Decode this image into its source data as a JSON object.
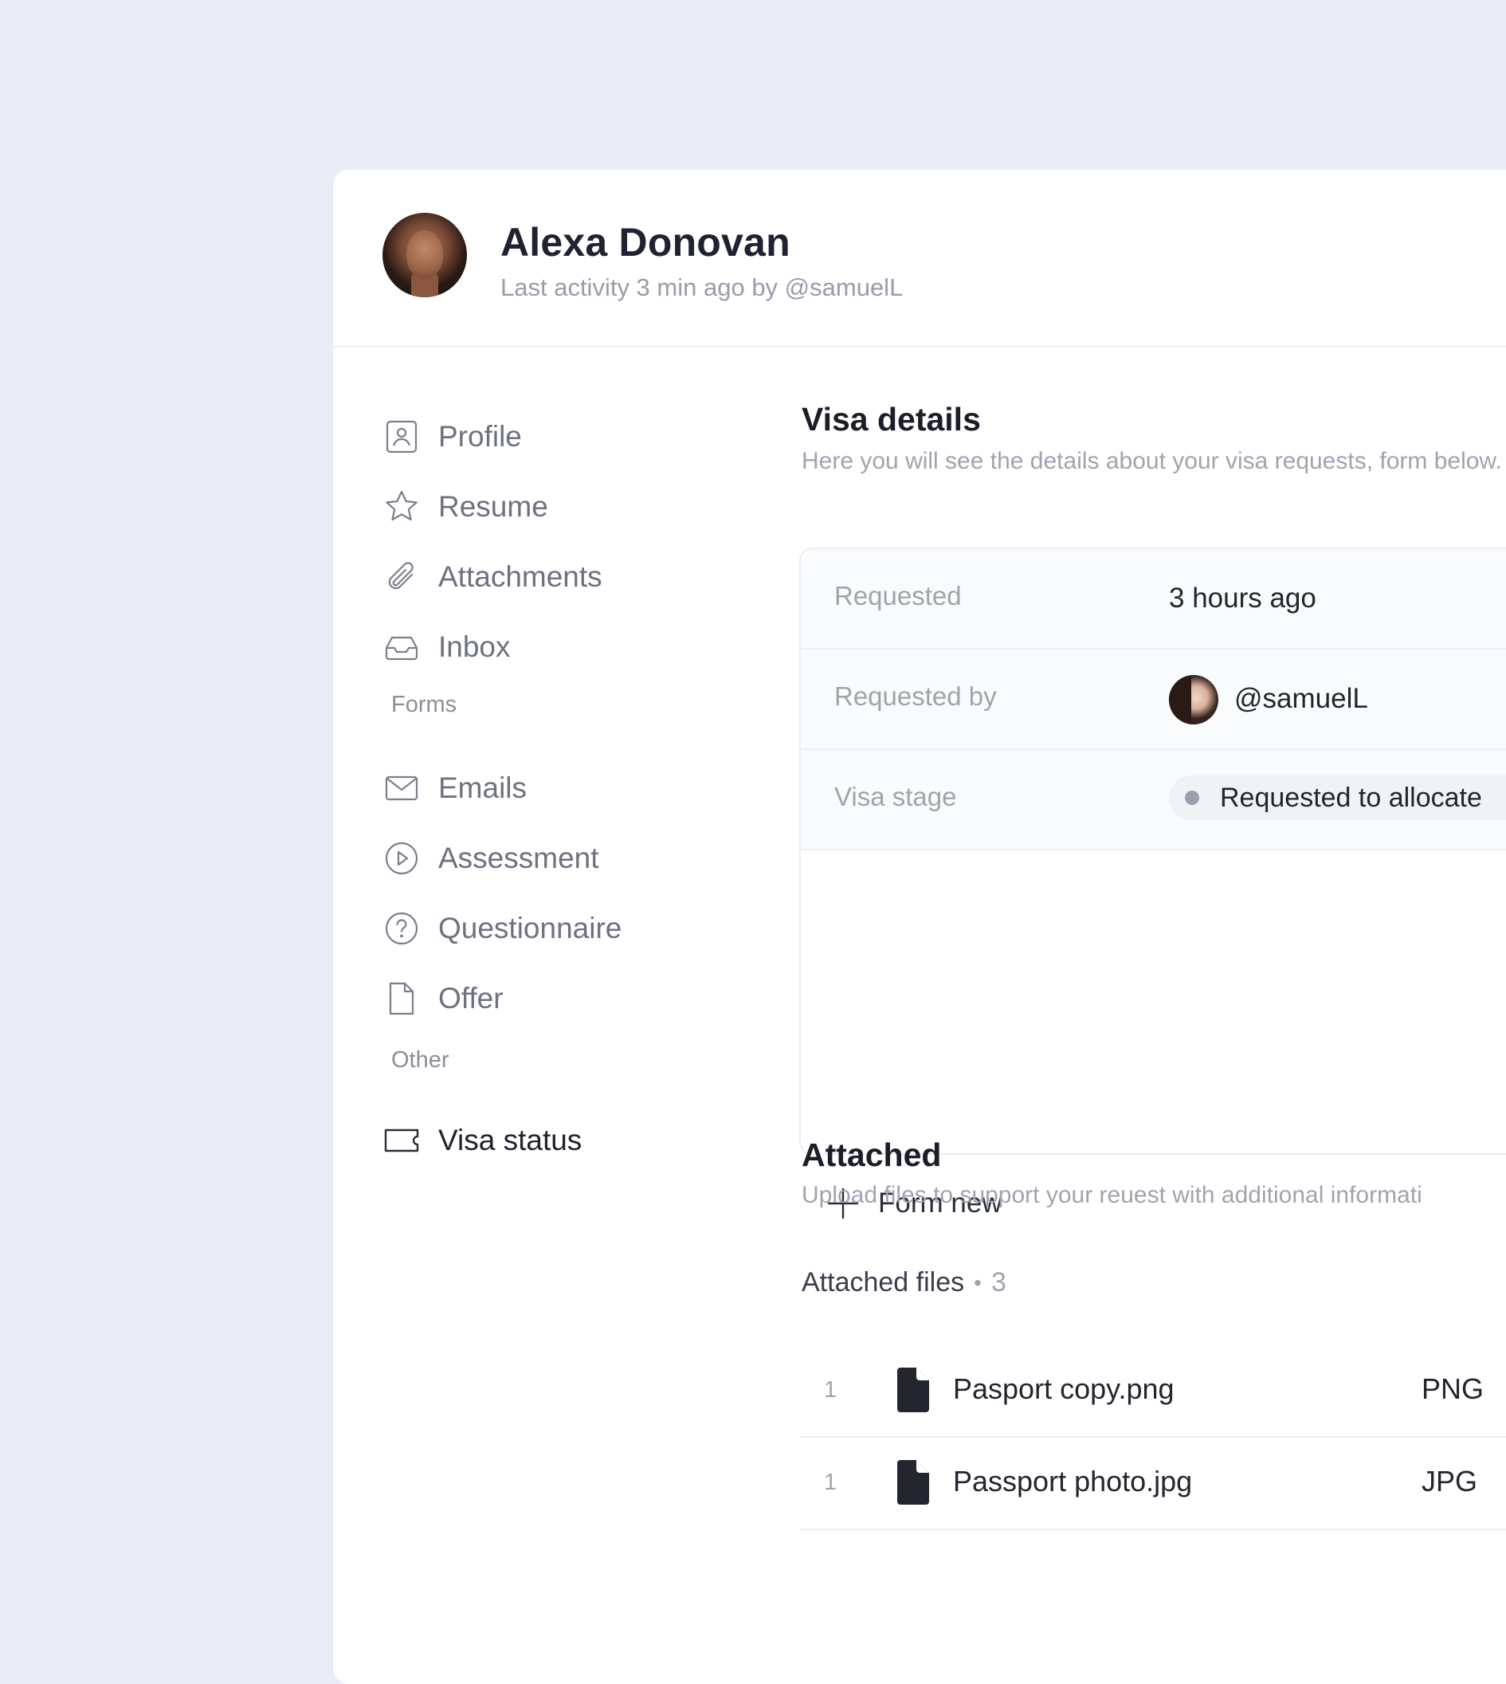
{
  "header": {
    "name": "Alexa Donovan",
    "activity": "Last activity 3 min ago by @samuelL"
  },
  "sidebar": {
    "items": [
      {
        "label": "Profile",
        "icon": "profile-icon"
      },
      {
        "label": "Resume",
        "icon": "star-icon"
      },
      {
        "label": "Attachments",
        "icon": "paperclip-icon"
      },
      {
        "label": "Inbox",
        "icon": "inbox-icon"
      }
    ],
    "forms_label": "Forms",
    "form_items": [
      {
        "label": "Emails",
        "icon": "mail-icon"
      },
      {
        "label": "Assessment",
        "icon": "play-circle-icon"
      },
      {
        "label": "Questionnaire",
        "icon": "question-circle-icon"
      },
      {
        "label": "Offer",
        "icon": "document-icon"
      }
    ],
    "other_label": "Other",
    "other_items": [
      {
        "label": "Visa status",
        "icon": "ticket-icon"
      }
    ]
  },
  "visa": {
    "title": "Visa details",
    "description": "Here you will see the details about your visa requests, form below.",
    "rows": {
      "requested_label": "Requested",
      "requested_value": "3 hours ago",
      "requested_by_label": "Requested by",
      "requested_by_value": "@samuelL",
      "stage_label": "Visa stage",
      "stage_value": "Requested to allocate"
    },
    "form_new": "Form new"
  },
  "attached": {
    "title": "Attached",
    "description": "Upload files to support your reuest with additional informati",
    "files_label": "Attached files",
    "files_sep": "•",
    "files_count": "3",
    "files": [
      {
        "num": "1",
        "name": "Pasport copy.png",
        "type": "PNG"
      },
      {
        "num": "1",
        "name": "Passport photo.jpg",
        "type": "JPG"
      }
    ]
  },
  "colors": {
    "background": "#e9ebf7",
    "card": "#ffffff",
    "text_primary": "#1f2231",
    "text_muted": "#9a9ca9"
  }
}
